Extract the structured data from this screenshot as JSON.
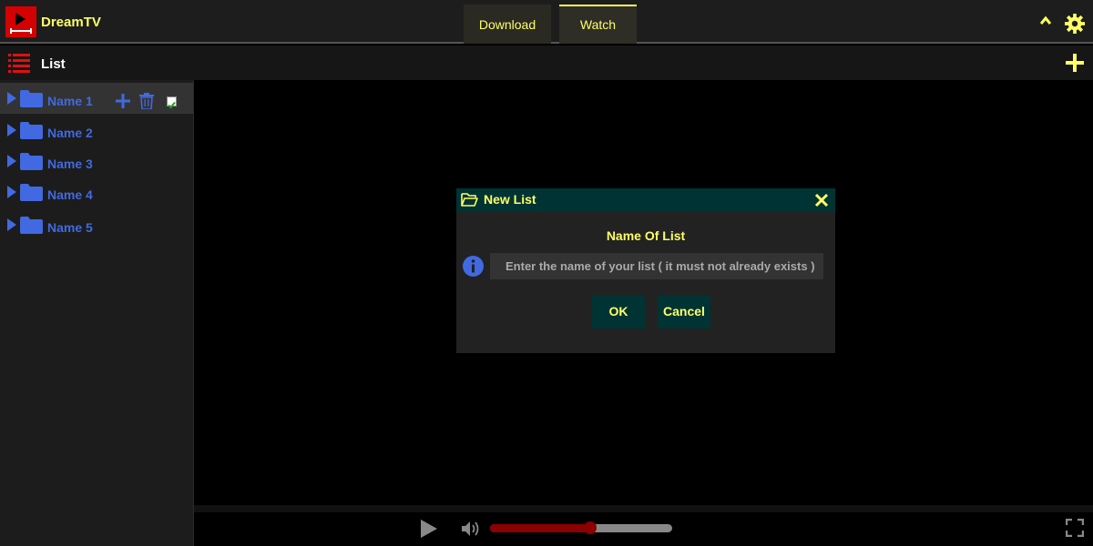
{
  "app": {
    "title": "DreamTV",
    "accent": "#ffff66",
    "brand": "#d40000",
    "folder_color": "#4169e1"
  },
  "tabs": [
    {
      "label": "Download"
    },
    {
      "label": "Watch",
      "active": true
    }
  ],
  "header_icons": [
    "chevron-up-icon",
    "gear-icon"
  ],
  "listbar": {
    "title": "List",
    "icon": "list-icon",
    "add_icon": "plus-icon"
  },
  "sidebar": {
    "items": [
      {
        "label": "Name 1",
        "selected": true,
        "checked": true
      },
      {
        "label": "Name 2"
      },
      {
        "label": "Name 3"
      },
      {
        "label": "Name 4"
      },
      {
        "label": "Name 5"
      }
    ]
  },
  "dialog": {
    "title": "New List",
    "field_label": "Name Of List",
    "placeholder": "Enter the name of your list ( it must not already exists )",
    "ok_label": "OK",
    "cancel_label": "Cancel"
  },
  "player": {
    "progress": 0.55
  }
}
